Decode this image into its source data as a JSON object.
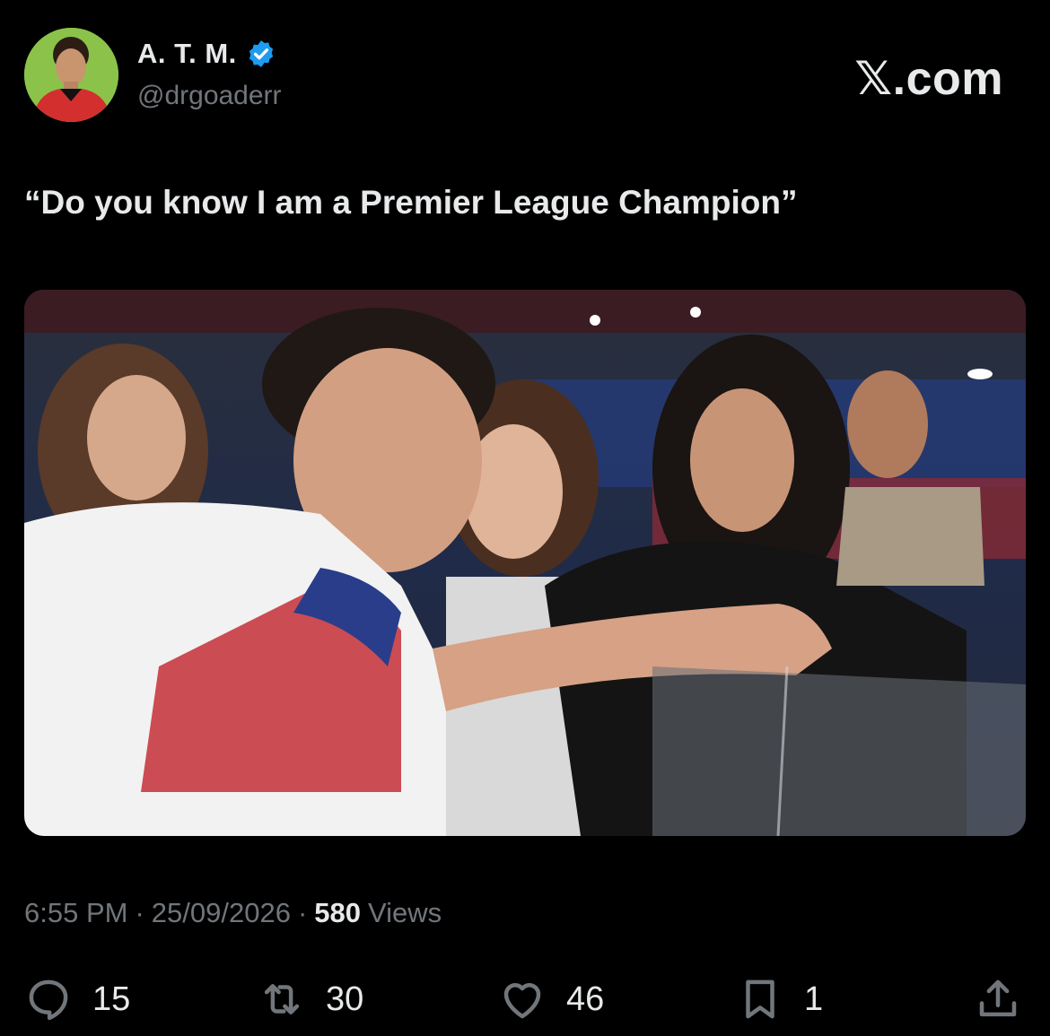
{
  "author": {
    "display_name": "A. T. M.",
    "handle": "@drgoaderr",
    "verified": true,
    "verified_color": "#1d9bf0"
  },
  "brand": "𝕏.com",
  "tweet": {
    "text": "“Do you know I am a Premier League Champion”"
  },
  "meta": {
    "time": "6:55 PM",
    "date": "25/09/2026",
    "views_count": "580",
    "views_label": "Views",
    "separator": "·"
  },
  "actions": {
    "replies": "15",
    "retweets": "30",
    "likes": "46",
    "bookmarks": "1"
  },
  "icons": {
    "reply": "reply-icon",
    "retweet": "retweet-icon",
    "like": "heart-icon",
    "bookmark": "bookmark-icon",
    "share": "share-icon"
  }
}
